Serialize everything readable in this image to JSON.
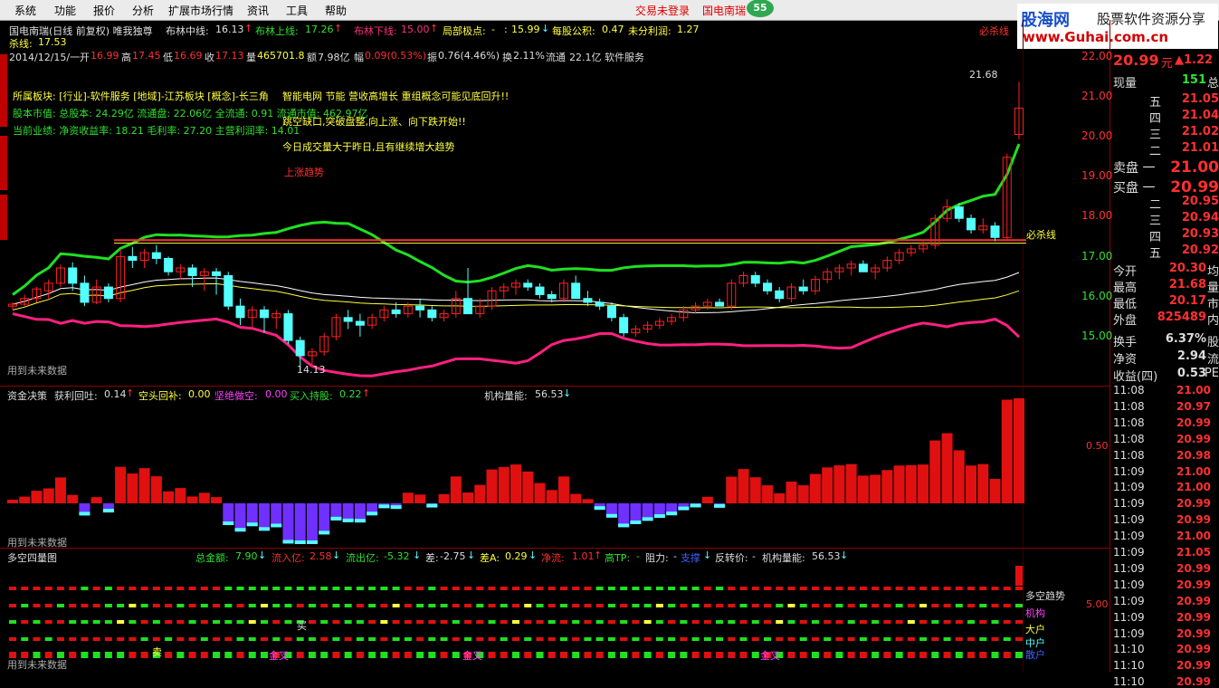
{
  "menu": {
    "items": [
      "系统",
      "功能",
      "报价",
      "分析",
      "扩展市场行情",
      "资讯",
      "工具",
      "帮助"
    ],
    "status_login": "交易未登录",
    "status_stock": "国电南瑞",
    "badge": "55"
  },
  "logo": {
    "main": "股海网",
    "sub": "股票软件资源分享",
    "url": "www.Guhai.com.cn"
  },
  "kline_header": {
    "title": "国电南瑞(日线 前复权) 唯我独尊",
    "boll_mid_label": "布林中线:",
    "boll_mid": "16.13",
    "boll_up_label": "布林上线:",
    "boll_up": "17.26",
    "boll_low_label": "布林下线:",
    "boll_low": "15.00",
    "local_label": "局部极点:",
    "local_a": "-",
    "local_b": "15.99",
    "eps_label": "每股公积:",
    "eps": "0.47",
    "undist_label": "未分利润:",
    "undist": "1.27",
    "kill_label": "杀线:",
    "kill": "17.53",
    "right_tag": "必杀线"
  },
  "info_line": {
    "date": "2014/12/15/一",
    "open_label": "开",
    "open": "16.99",
    "high_label": "高",
    "high": "17.45",
    "low_label": "低",
    "low": "16.69",
    "close_label": "收",
    "close": "17.13",
    "vol_label": "量",
    "vol": "465701.8",
    "amt_label": "额",
    "amt": "7.98亿",
    "chg_label": "幅",
    "chg": "0.09(0.53%)",
    "amp_label": "振",
    "amp": "0.76(4.46%)",
    "turn_label": "换",
    "turn": "2.11%",
    "float_label": "流通",
    "float": "22.1亿",
    "industry": "软件服务"
  },
  "notes": {
    "sector": "所属板块: [行业]-软件服务 [地域]-江苏板块 [概念]-长三角",
    "capital": "股本市值: 总股本: 24.29亿 流通盘: 22.06亿 全流通: 0.91 流通市值: 462.97亿",
    "perf": "当前业绩: 净资收益率: 18.21 毛利率: 27.20 主营利润率: 14.01",
    "overlay1": "智能电网 节能 营收高增长 重组概念可能见底回升!!",
    "overlay2": "跳空缺口,突破盘整,向上涨、向下跌开始!!",
    "overlay3": "今日成交量大于昨日,且有继续增大趋势",
    "trend": "上涨趋势",
    "low_mark": "14.13",
    "high_mark": "21.68",
    "future": "用到未来数据",
    "kill_right": "必杀线"
  },
  "price_axis": [
    "22.00",
    "21.00",
    "20.00",
    "19.00",
    "18.00",
    "17.00",
    "16.00",
    "15.00"
  ],
  "fund_header": {
    "title": "资金决策",
    "profit_label": "获利回吐:",
    "profit": "0.14",
    "short_label": "空头回补:",
    "short": "0.00",
    "bear_label": "坚绝做空:",
    "bear": "0.00",
    "buy_label": "买入持股:",
    "buy": "0.22",
    "inst_label": "机构量能:",
    "inst": "56.53",
    "axis": "0.50",
    "future": "用到未来数据"
  },
  "quad_header": {
    "title": "多空四量图",
    "total_label": "总金额:",
    "total": "7.90",
    "in_label": "流入亿:",
    "in": "2.58",
    "out_label": "流出亿:",
    "out": "-5.32",
    "diff_label": "差:",
    "diff": "-2.75",
    "diffa_label": "差A:",
    "diffa": "0.29",
    "net_label": "净流:",
    "net": "1.01",
    "tp_label": "高TP:",
    "tp": "-",
    "res_label": "阻力:",
    "res": "-",
    "sup": "支撑",
    "rev_label": "反转价:",
    "rev": "-",
    "inst_label": "机构量能:",
    "inst": "56.53",
    "axis": "5.00",
    "legend": [
      "多空趋势",
      "机构",
      "大户",
      "中户",
      "散户"
    ],
    "marks": {
      "buy": "买",
      "gold": "金叉",
      "sell": "卖"
    },
    "future": "用到未来数据"
  },
  "quote": {
    "price": "20.99",
    "unit": "元",
    "chg": "▲1.22",
    "now_label": "现量",
    "now": "151",
    "total_tag": "总",
    "asks": [
      {
        "l": "五",
        "v": "21.05"
      },
      {
        "l": "四",
        "v": "21.04"
      },
      {
        "l": "三",
        "v": "21.02"
      },
      {
        "l": "二",
        "v": "21.01"
      }
    ],
    "ask1_label": "卖盘 一",
    "ask1": "21.00",
    "bid1_label": "买盘 一",
    "bid1": "20.99",
    "bids": [
      {
        "l": "二",
        "v": "20.95"
      },
      {
        "l": "三",
        "v": "20.94"
      },
      {
        "l": "四",
        "v": "20.93"
      },
      {
        "l": "五",
        "v": "20.92"
      }
    ],
    "stats": [
      {
        "l": "今开",
        "v": "20.30",
        "e": "均"
      },
      {
        "l": "最高",
        "v": "21.68",
        "e": "量"
      },
      {
        "l": "最低",
        "v": "20.17",
        "e": "市"
      },
      {
        "l": "外盘",
        "v": "825489",
        "e": "内"
      },
      {
        "l": "换手",
        "v": "6.37%",
        "e": "股"
      },
      {
        "l": "净资",
        "v": "2.94",
        "e": "流"
      },
      {
        "l": "收益(四)",
        "v": "0.53",
        "e": "PE"
      }
    ],
    "ticks": [
      {
        "t": "11:08",
        "p": "21.00"
      },
      {
        "t": "11:08",
        "p": "20.97"
      },
      {
        "t": "11:08",
        "p": "20.99"
      },
      {
        "t": "11:08",
        "p": "20.99"
      },
      {
        "t": "11:08",
        "p": "20.98"
      },
      {
        "t": "11:09",
        "p": "21.00"
      },
      {
        "t": "11:09",
        "p": "21.00"
      },
      {
        "t": "11:09",
        "p": "20.99"
      },
      {
        "t": "11:09",
        "p": "20.99"
      },
      {
        "t": "11:09",
        "p": "21.00"
      },
      {
        "t": "11:09",
        "p": "21.05"
      },
      {
        "t": "11:09",
        "p": "20.99"
      },
      {
        "t": "11:09",
        "p": "20.99"
      },
      {
        "t": "11:09",
        "p": "20.99"
      },
      {
        "t": "11:09",
        "p": "20.99"
      },
      {
        "t": "11:09",
        "p": "20.99"
      },
      {
        "t": "11:10",
        "p": "20.99"
      },
      {
        "t": "11:10",
        "p": "20.99"
      },
      {
        "t": "11:10",
        "p": "20.99"
      }
    ]
  },
  "colors": {
    "up": "#ff2020",
    "down": "#54ffff",
    "boll_up": "#20e020",
    "boll_low": "#ff2080",
    "mid": "#ffff40",
    "kill": "#ff3030",
    "purple": "#7030ff"
  },
  "chart_data": {
    "type": "candlestick",
    "title": "国电南瑞(日线 前复权)",
    "ylim": [
      14,
      22.4
    ],
    "candles": [
      [
        15.8,
        15.9,
        15.7,
        15.85
      ],
      [
        15.85,
        16.1,
        15.8,
        16.0
      ],
      [
        16.0,
        16.3,
        15.9,
        16.25
      ],
      [
        16.2,
        16.5,
        16.0,
        16.4
      ],
      [
        16.4,
        16.9,
        16.3,
        16.8
      ],
      [
        16.8,
        16.95,
        16.2,
        16.4
      ],
      [
        16.4,
        16.6,
        15.8,
        15.9
      ],
      [
        15.9,
        16.5,
        15.85,
        16.3
      ],
      [
        16.3,
        16.4,
        15.9,
        16.0
      ],
      [
        16.0,
        17.3,
        15.9,
        17.1
      ],
      [
        17.1,
        17.35,
        16.8,
        17.0
      ],
      [
        17.0,
        17.3,
        16.8,
        17.2
      ],
      [
        17.2,
        17.4,
        16.9,
        17.05
      ],
      [
        17.05,
        17.1,
        16.6,
        16.7
      ],
      [
        16.7,
        16.9,
        16.5,
        16.8
      ],
      [
        16.8,
        16.9,
        16.3,
        16.6
      ],
      [
        16.6,
        16.8,
        16.2,
        16.7
      ],
      [
        16.7,
        16.8,
        16.1,
        16.6
      ],
      [
        16.6,
        16.7,
        15.7,
        15.8
      ],
      [
        15.8,
        16.0,
        15.3,
        15.5
      ],
      [
        15.5,
        15.8,
        15.2,
        15.7
      ],
      [
        15.7,
        15.8,
        15.1,
        15.5
      ],
      [
        15.5,
        15.7,
        15.2,
        15.6
      ],
      [
        15.6,
        15.7,
        14.8,
        14.9
      ],
      [
        14.9,
        15.0,
        14.13,
        14.5
      ],
      [
        14.5,
        14.7,
        14.2,
        14.6
      ],
      [
        14.6,
        15.1,
        14.5,
        15.0
      ],
      [
        15.0,
        15.6,
        14.9,
        15.5
      ],
      [
        15.5,
        15.7,
        15.2,
        15.4
      ],
      [
        15.4,
        15.6,
        15.0,
        15.3
      ],
      [
        15.3,
        15.6,
        15.2,
        15.5
      ],
      [
        15.5,
        15.8,
        15.4,
        15.7
      ],
      [
        15.7,
        15.9,
        15.5,
        15.6
      ],
      [
        15.6,
        15.9,
        15.5,
        15.8
      ],
      [
        15.8,
        16.0,
        15.5,
        15.7
      ],
      [
        15.7,
        15.8,
        15.4,
        15.5
      ],
      [
        15.5,
        15.7,
        15.4,
        15.6
      ],
      [
        15.6,
        16.2,
        15.5,
        16.0
      ],
      [
        16.0,
        16.8,
        15.9,
        15.6
      ],
      [
        15.6,
        16.0,
        15.5,
        15.8
      ],
      [
        15.8,
        16.3,
        15.7,
        16.2
      ],
      [
        16.2,
        16.4,
        16.0,
        16.3
      ],
      [
        16.3,
        16.5,
        16.1,
        16.4
      ],
      [
        16.4,
        16.5,
        16.2,
        16.3
      ],
      [
        16.3,
        16.4,
        16.0,
        16.1
      ],
      [
        16.1,
        16.2,
        15.9,
        16.0
      ],
      [
        16.0,
        16.5,
        15.9,
        16.4
      ],
      [
        16.4,
        16.6,
        16.3,
        16.0
      ],
      [
        16.0,
        16.2,
        15.8,
        15.9
      ],
      [
        15.9,
        16.0,
        15.7,
        15.8
      ],
      [
        15.8,
        15.9,
        15.4,
        15.5
      ],
      [
        15.5,
        15.6,
        15.0,
        15.1
      ],
      [
        15.1,
        15.3,
        15.0,
        15.2
      ],
      [
        15.2,
        15.4,
        15.1,
        15.3
      ],
      [
        15.3,
        15.5,
        15.2,
        15.4
      ],
      [
        15.4,
        15.6,
        15.3,
        15.5
      ],
      [
        15.5,
        15.8,
        15.4,
        15.7
      ],
      [
        15.7,
        15.9,
        15.6,
        15.8
      ],
      [
        15.8,
        16.0,
        15.7,
        15.9
      ],
      [
        15.9,
        16.0,
        15.8,
        15.8
      ],
      [
        15.8,
        16.5,
        15.7,
        16.4
      ],
      [
        16.4,
        16.7,
        16.3,
        16.6
      ],
      [
        16.6,
        16.7,
        16.3,
        16.4
      ],
      [
        16.4,
        16.5,
        16.1,
        16.2
      ],
      [
        16.2,
        16.3,
        15.9,
        16.0
      ],
      [
        16.0,
        16.4,
        15.9,
        16.3
      ],
      [
        16.3,
        16.5,
        16.1,
        16.2
      ],
      [
        16.2,
        16.6,
        16.1,
        16.5
      ],
      [
        16.5,
        16.8,
        16.4,
        16.7
      ],
      [
        16.7,
        16.9,
        16.5,
        16.8
      ],
      [
        16.8,
        17.0,
        16.6,
        16.9
      ],
      [
        16.9,
        17.0,
        16.7,
        16.7
      ],
      [
        16.7,
        16.9,
        16.5,
        16.8
      ],
      [
        16.8,
        17.1,
        16.7,
        17.0
      ],
      [
        17.0,
        17.3,
        16.9,
        17.2
      ],
      [
        17.2,
        17.4,
        17.1,
        17.3
      ],
      [
        17.3,
        17.5,
        17.2,
        17.4
      ],
      [
        17.4,
        18.2,
        17.3,
        18.1
      ],
      [
        18.1,
        18.6,
        18.0,
        18.4
      ],
      [
        18.4,
        18.5,
        18.0,
        18.1
      ],
      [
        18.1,
        18.2,
        17.7,
        17.8
      ],
      [
        17.8,
        18.1,
        17.7,
        17.9
      ],
      [
        17.9,
        18.0,
        17.5,
        17.6
      ],
      [
        17.6,
        19.8,
        17.5,
        19.7
      ],
      [
        20.3,
        21.68,
        20.17,
        20.99
      ]
    ]
  }
}
